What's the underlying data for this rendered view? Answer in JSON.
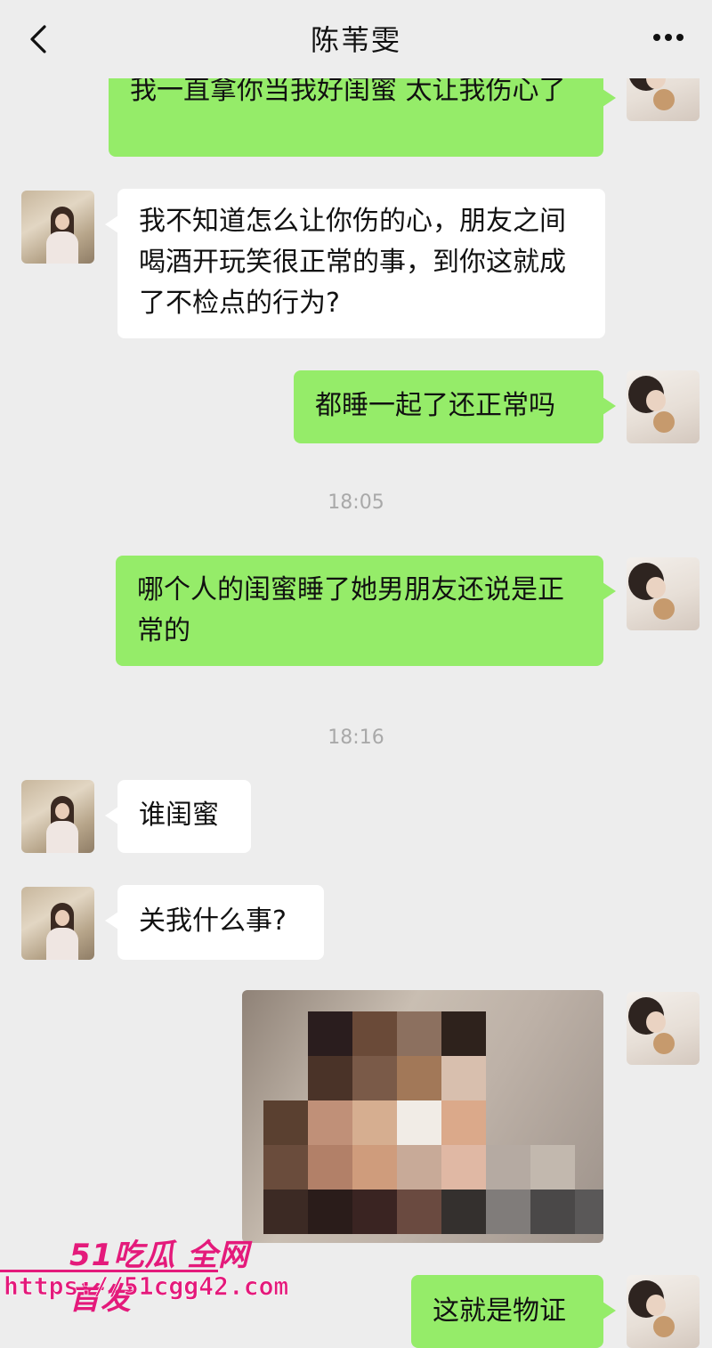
{
  "header": {
    "back_icon": "chevron-left-icon",
    "title": "陈苇雯",
    "more_icon": "more-dots-icon"
  },
  "messages": [
    {
      "from": "me",
      "text": "我一直拿你当我好闺蜜 太让我伤心了"
    },
    {
      "from": "her",
      "text": "我不知道怎么让你伤的心，朋友之间喝酒开玩笑很正常的事，到你这就成了不检点的行为?"
    },
    {
      "from": "me",
      "text": "都睡一起了还正常吗"
    },
    {
      "type": "time",
      "text": "18:05"
    },
    {
      "from": "me",
      "text": "哪个人的闺蜜睡了她男朋友还说是正常的"
    },
    {
      "type": "time",
      "text": "18:16"
    },
    {
      "from": "her",
      "text": "谁闺蜜"
    },
    {
      "from": "her",
      "text": "关我什么事?"
    },
    {
      "from": "me",
      "type": "image",
      "content": "pixelated-photo"
    },
    {
      "from": "me",
      "text": "这就是物证"
    }
  ],
  "watermark": {
    "brand": "51吃瓜 全网首发",
    "url": "https://51cgg42.com"
  },
  "colors": {
    "background": "#ededed",
    "outgoing_bubble": "#95ec69",
    "incoming_bubble": "#ffffff",
    "watermark": "#e41a7b"
  }
}
